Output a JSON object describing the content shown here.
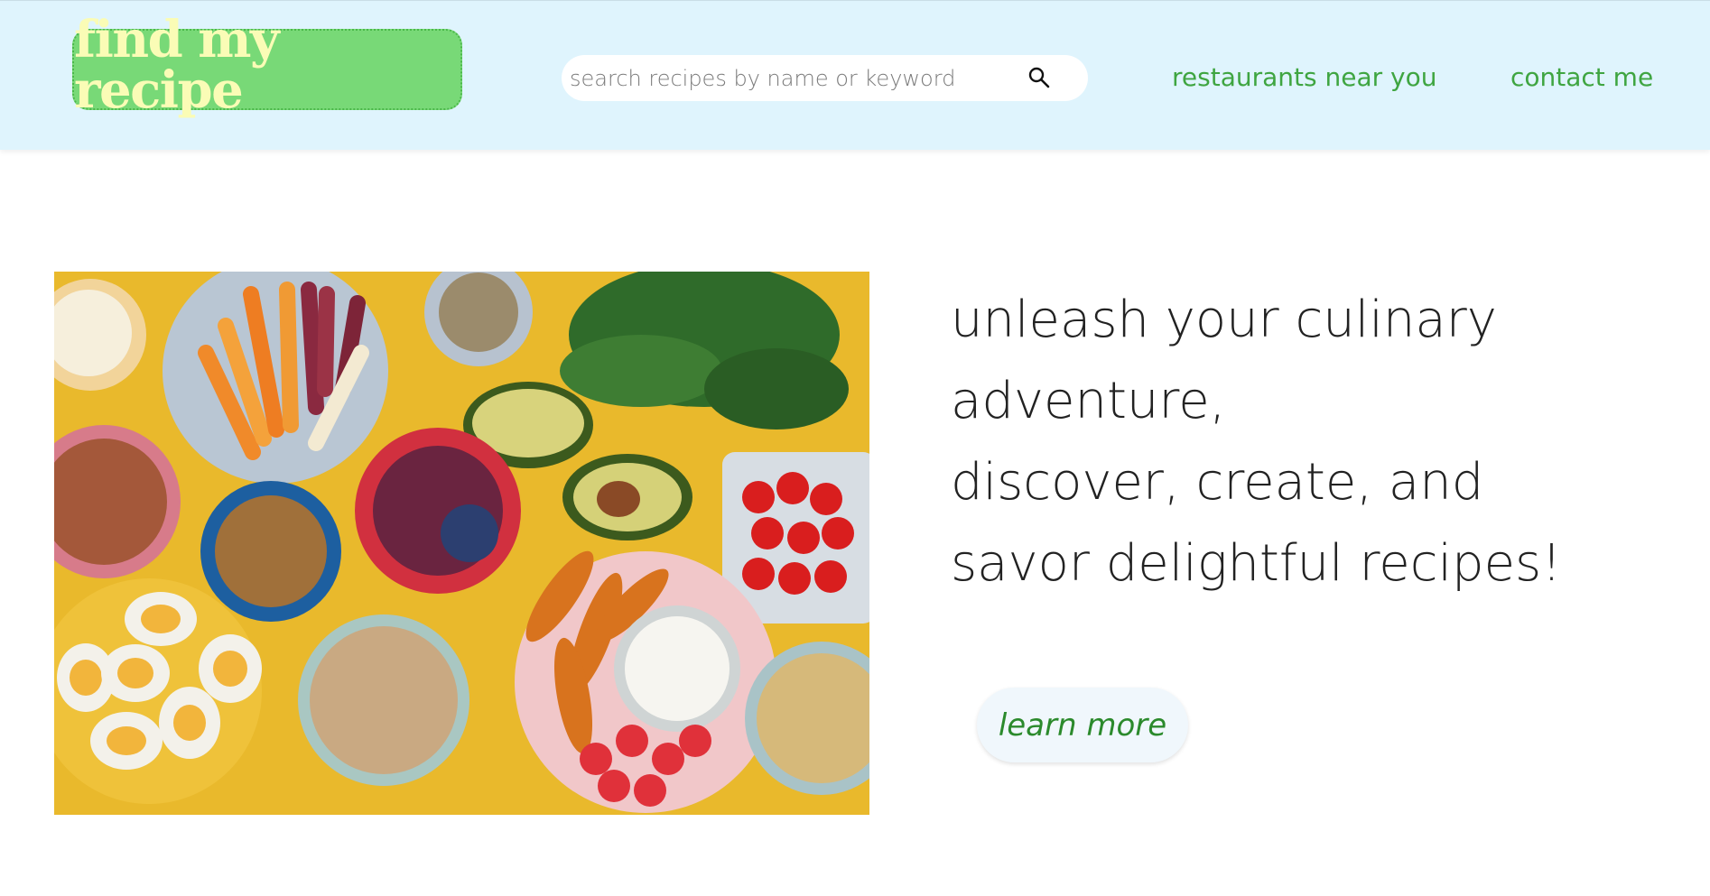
{
  "header": {
    "logo_text": "find my recipe",
    "search": {
      "placeholder": "search recipes by name or keyword",
      "value": ""
    },
    "nav": [
      {
        "label": "restaurants near you"
      },
      {
        "label": "contact me"
      }
    ]
  },
  "hero": {
    "image": "healthy-food-spread-photo",
    "headline_lines": [
      "unleash your culinary",
      "adventure,",
      "discover, create, and",
      "savor delightful recipes!"
    ],
    "cta_label": "learn more"
  },
  "colors": {
    "header_bg": "#dff4fd",
    "logo_bg": "#78d977",
    "logo_text": "#fafcb6",
    "nav_link": "#3fa541",
    "cta_text": "#2b8a2c",
    "headline": "#222222"
  }
}
